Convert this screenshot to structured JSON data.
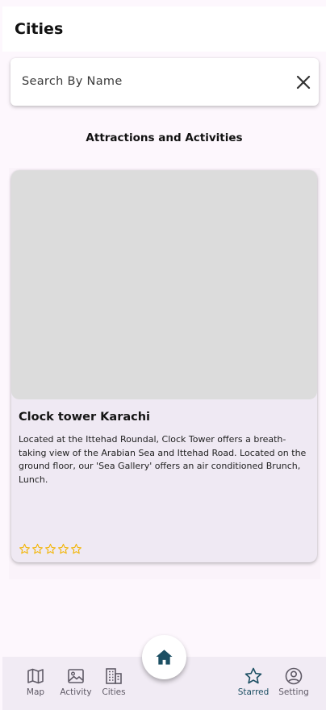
{
  "appbar": {
    "title": "Cities"
  },
  "search": {
    "placeholder": "Search By Name",
    "value": ""
  },
  "section": {
    "title": "Attractions and Activities"
  },
  "cards": [
    {
      "title": "Clock tower Karachi",
      "description": "Located at the Ittehad Roundal, Clock Tower offers a breath-taking view of the Arabian Sea and Ittehad Road. Located on the ground floor, our 'Sea Gallery' offers an air conditioned Brunch, Lunch.",
      "rating": 0,
      "rating_max": 5
    }
  ],
  "bottom_nav": {
    "items": [
      {
        "label": "Map",
        "icon": "map-icon"
      },
      {
        "label": "Activity",
        "icon": "image-icon"
      },
      {
        "label": "Cities",
        "icon": "building-icon"
      },
      {
        "label": "Starred",
        "icon": "star-icon",
        "active": true
      },
      {
        "label": "Setting",
        "icon": "account-circle-icon"
      }
    ],
    "center_button_icon": "home-icon"
  },
  "colors": {
    "accent": "#1c4f63",
    "star": "#f2b400",
    "card_bg": "#efe9f3",
    "nav_bg": "#f1ebf4"
  }
}
